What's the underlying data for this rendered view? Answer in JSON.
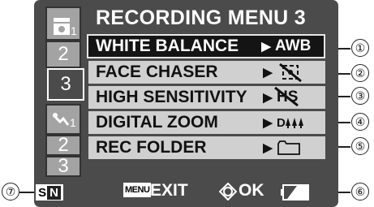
{
  "title": "RECORDING MENU 3",
  "tabs": {
    "group1": [
      "1",
      "2",
      "3"
    ],
    "group2": [
      "1",
      "2",
      "3"
    ],
    "active": "3"
  },
  "menu": [
    {
      "label": "WHITE BALANCE",
      "value": "AWB",
      "value_icon": "awb-icon",
      "selected": true
    },
    {
      "label": "FACE CHASER",
      "value_icon": "face-chaser-off-icon"
    },
    {
      "label": "HIGH SENSITIVITY",
      "value": "HS",
      "value_icon": "high-sensitivity-off-icon"
    },
    {
      "label": "DIGITAL ZOOM",
      "value": "D",
      "value_icon": "digital-zoom-icon"
    },
    {
      "label": "REC FOLDER",
      "value_icon": "folder-icon"
    }
  ],
  "footer": {
    "menu_button": "MENU",
    "exit": "EXIT",
    "ok": "OK",
    "sn_s": "S",
    "sn_n": "N"
  },
  "callouts": [
    "①",
    "②",
    "③",
    "④",
    "⑤",
    "⑥",
    "⑦"
  ],
  "colors": {
    "panel": "#4b4b4b",
    "item_bg": "#d0d0d0",
    "selected_bg": "#141414"
  }
}
